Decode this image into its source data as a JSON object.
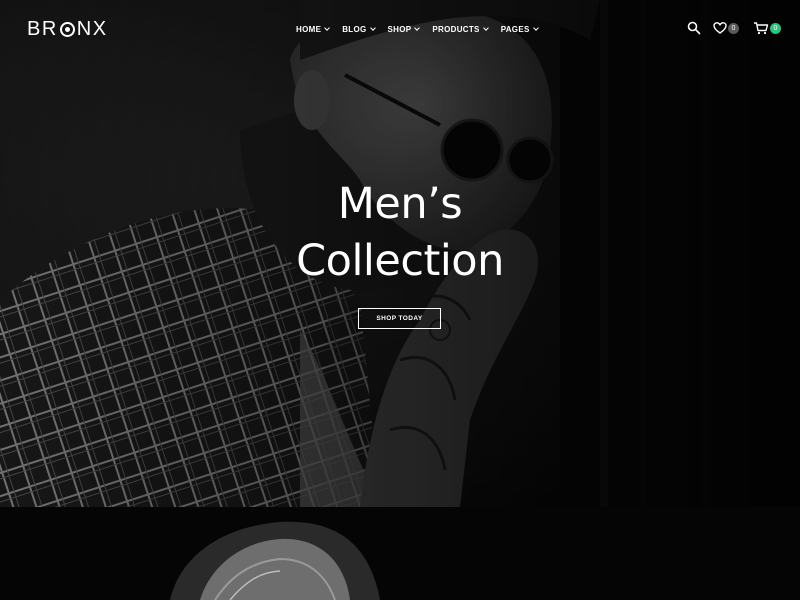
{
  "brand": {
    "logo_text_left": "BR",
    "logo_text_right": "NX"
  },
  "nav": [
    {
      "label": "HOME"
    },
    {
      "label": "BLOG"
    },
    {
      "label": "SHOP"
    },
    {
      "label": "PRODUCTS"
    },
    {
      "label": "PAGES"
    }
  ],
  "header_icons": {
    "search": "search-icon",
    "wishlist": "heart-icon",
    "cart": "cart-icon",
    "wishlist_count": "0",
    "cart_count": "0",
    "cart_badge_color": "#2ec27e"
  },
  "hero": {
    "title_line1": "Men’s",
    "title_line2": "Collection",
    "cta_label": "SHOP TODAY"
  }
}
